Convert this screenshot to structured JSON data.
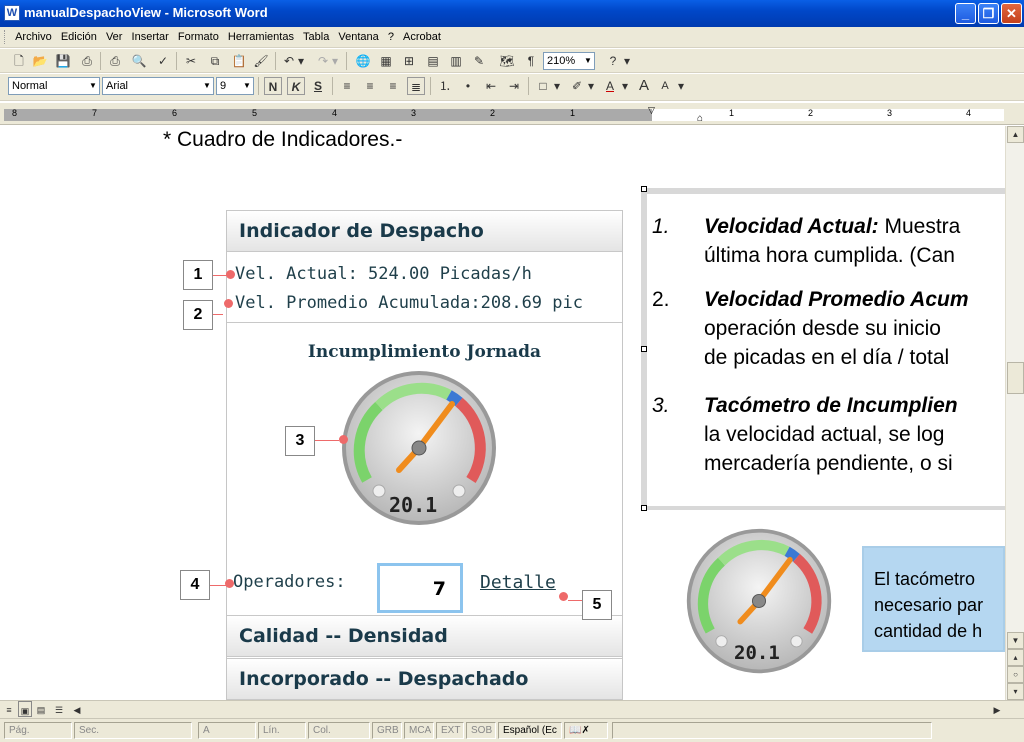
{
  "window": {
    "title": "manualDespachoView - Microsoft Word"
  },
  "menu": [
    "Archivo",
    "Edición",
    "Ver",
    "Insertar",
    "Formato",
    "Herramientas",
    "Tabla",
    "Ventana",
    "?",
    "Acrobat"
  ],
  "toolbar": {
    "zoom": "210%",
    "style": "Normal",
    "font": "Arial",
    "size": "9",
    "bold": "N",
    "italic": "K",
    "underline": "S"
  },
  "ruler": {
    "left_numbers": [
      "8",
      "7",
      "6",
      "5",
      "4",
      "3",
      "2",
      "1"
    ],
    "right_numbers": [
      "1",
      "2",
      "3",
      "4"
    ]
  },
  "doc": {
    "heading": "* Cuadro de Indicadores.-",
    "panel": {
      "title": "Indicador de Despacho",
      "vel_actual": "Vel. Actual: 524.00 Picadas/h",
      "vel_promedio": "Vel. Promedio Acumulada:208.69 pic",
      "gauge_title": "Incumplimiento Jornada",
      "gauge_value": "20.1",
      "operadores_label": "Operadores:",
      "operadores_value": "7",
      "detalle_link": "Detalle",
      "section_calidad": "Calidad -- Densidad",
      "section_incorporado": "Incorporado -- Despachado"
    },
    "callouts": [
      "1",
      "2",
      "3",
      "4",
      "5"
    ],
    "list": [
      {
        "num": "1.",
        "title": "Velocidad Actual:",
        "text": " Muestra",
        "line2": "última hora cumplida. (Can"
      },
      {
        "num": "2.",
        "title": "Velocidad Promedio Acum",
        "line2": "operación desde su inicio",
        "line3": "de picadas en el día / total"
      },
      {
        "num": "3.",
        "title": "Tacómetro de Incumplien",
        "line2": "la velocidad actual, se log",
        "line3": "mercadería pendiente, o si"
      }
    ],
    "gauge2_value": "20.1",
    "note": [
      "El tacómetro",
      "necesario par",
      "cantidad de h"
    ]
  },
  "status": {
    "pag": "Pág.",
    "sec": "Sec.",
    "a": "A",
    "lin": "Lín.",
    "col": "Col.",
    "grb": "GRB",
    "mca": "MCA",
    "ext": "EXT",
    "sob": "SOB",
    "lang": "Español (Ec"
  }
}
